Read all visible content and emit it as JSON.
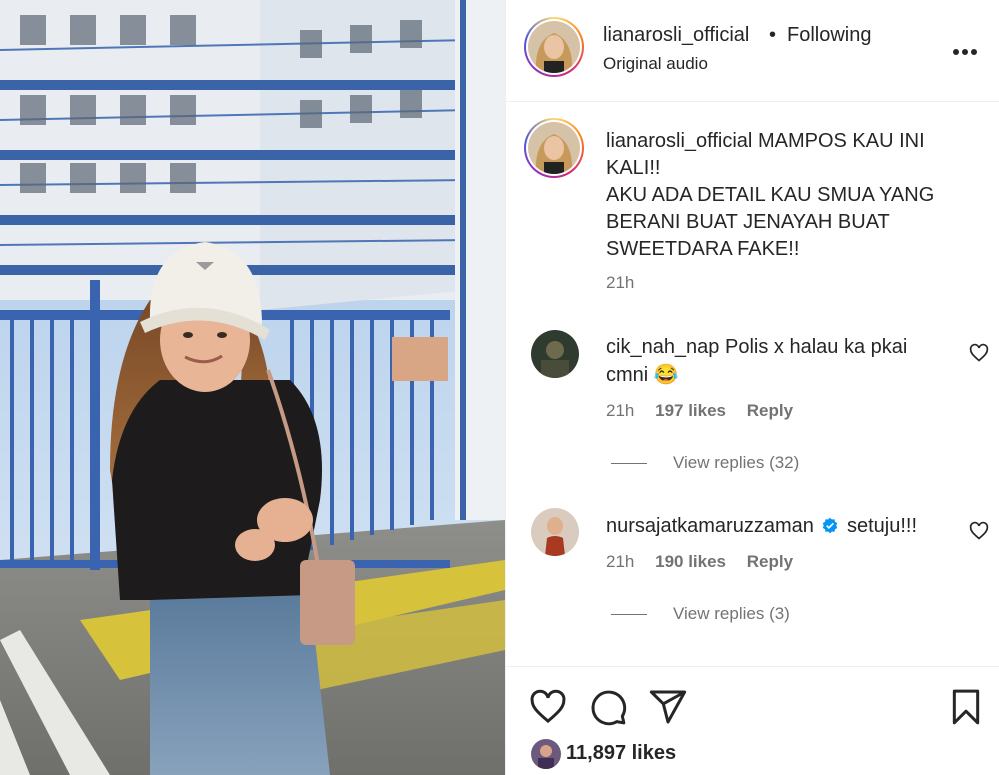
{
  "header": {
    "username": "lianarosli_official",
    "separator": "•",
    "follow_status": "Following",
    "audio": "Original audio",
    "more_icon": "more-horizontal-icon"
  },
  "caption": {
    "username": "lianarosli_official",
    "text_line1": "MAMPOS KAU INI KALI!!",
    "text_line2": "AKU ADA DETAIL KAU SMUA YANG BERANI BUAT JENAYAH BUAT SWEETDARA FAKE!!",
    "time": "21h"
  },
  "comments": [
    {
      "username": "cik_nah_nap",
      "text": "Polis x halau ka pkai cmni",
      "emoji": "😂",
      "time": "21h",
      "likes": "197 likes",
      "reply": "Reply",
      "view_replies": "View replies (32)",
      "verified": false
    },
    {
      "username": "nursajatkamaruzzaman",
      "text": "setuju!!!",
      "time": "21h",
      "likes": "190 likes",
      "reply": "Reply",
      "view_replies": "View replies (3)",
      "verified": true
    }
  ],
  "actions": {
    "like_icon": "heart-icon",
    "comment_icon": "comment-icon",
    "share_icon": "send-icon",
    "save_icon": "bookmark-icon",
    "likes_count": "11,897 likes"
  },
  "colors": {
    "text_primary": "#262626",
    "text_secondary": "#737373",
    "verified": "#0095f6",
    "divider": "#efefef"
  }
}
